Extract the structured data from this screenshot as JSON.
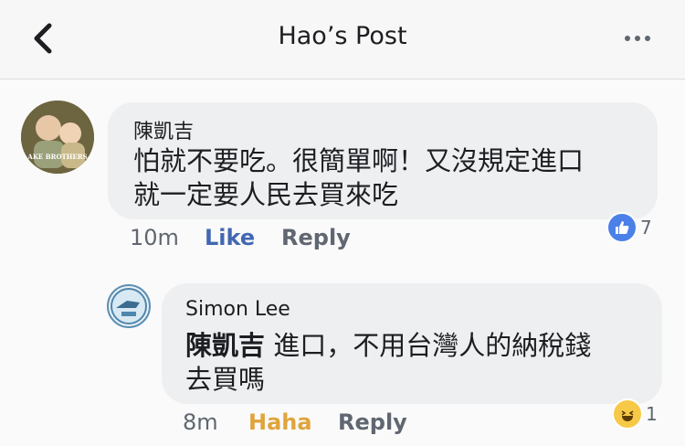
{
  "header": {
    "title": "Hao’s Post",
    "back_icon": "chevron-left-icon",
    "more_icon": "ellipsis-icon"
  },
  "comments": [
    {
      "author": "陳凱吉",
      "avatar_text": "AKE BROTHERS",
      "text_line1": "怕就不要吃。很簡單啊！又沒規定進口",
      "text_line2": "就一定要人民去買來吃",
      "time": "10m",
      "action1": "Like",
      "action2": "Reply",
      "reaction_icon": "like-icon",
      "reaction_count": "7"
    },
    {
      "author": "Simon Lee",
      "mention": "陳凱吉",
      "text_rest": " 進口，不用台灣人的納稅錢",
      "text_line2": "去買嗎",
      "time": "8m",
      "action1": "Haha",
      "action2": "Reply",
      "reaction_icon": "haha-icon",
      "reaction_count": "1"
    }
  ],
  "colors": {
    "like_blue": "#4267b2",
    "haha_gold": "#e0a43b",
    "bubble_gray": "#eeeff1"
  }
}
